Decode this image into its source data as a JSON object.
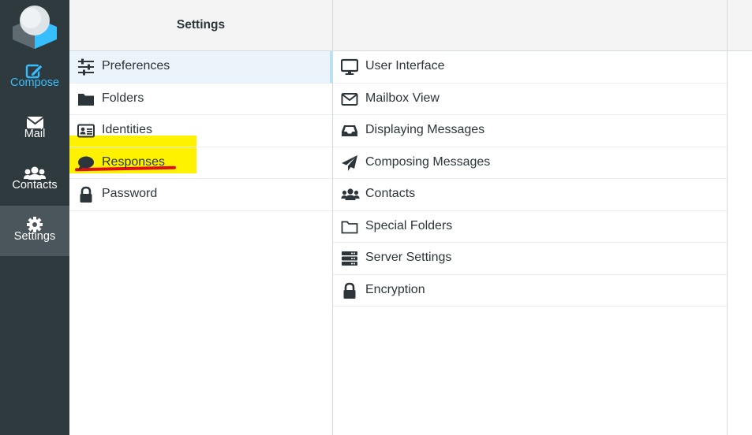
{
  "nav": {
    "items": [
      {
        "label": "Compose",
        "icon": "compose-icon"
      },
      {
        "label": "Mail",
        "icon": "envelope-icon"
      },
      {
        "label": "Contacts",
        "icon": "users-icon"
      },
      {
        "label": "Settings",
        "icon": "gear-icon"
      }
    ],
    "active": "Settings"
  },
  "settings": {
    "title": "Settings",
    "items": [
      {
        "label": "Preferences",
        "icon": "sliders-icon",
        "selected": true
      },
      {
        "label": "Folders",
        "icon": "folder-icon"
      },
      {
        "label": "Identities",
        "icon": "id-card-icon"
      },
      {
        "label": "Responses",
        "icon": "comment-icon"
      },
      {
        "label": "Password",
        "icon": "lock-icon"
      }
    ]
  },
  "sections": {
    "items": [
      {
        "label": "User Interface",
        "icon": "monitor-icon"
      },
      {
        "label": "Mailbox View",
        "icon": "envelope-outline-icon"
      },
      {
        "label": "Displaying Messages",
        "icon": "inbox-icon"
      },
      {
        "label": "Composing Messages",
        "icon": "paper-plane-icon"
      },
      {
        "label": "Contacts",
        "icon": "users-icon"
      },
      {
        "label": "Special Folders",
        "icon": "folder-outline-icon"
      },
      {
        "label": "Server Settings",
        "icon": "server-icon"
      },
      {
        "label": "Encryption",
        "icon": "lock-icon"
      }
    ]
  },
  "colors": {
    "nav_bg": "#2f3a3f",
    "nav_active_bg": "#4a565b",
    "accent": "#37beff",
    "highlight": "#fff200",
    "underline": "#e0101b"
  }
}
